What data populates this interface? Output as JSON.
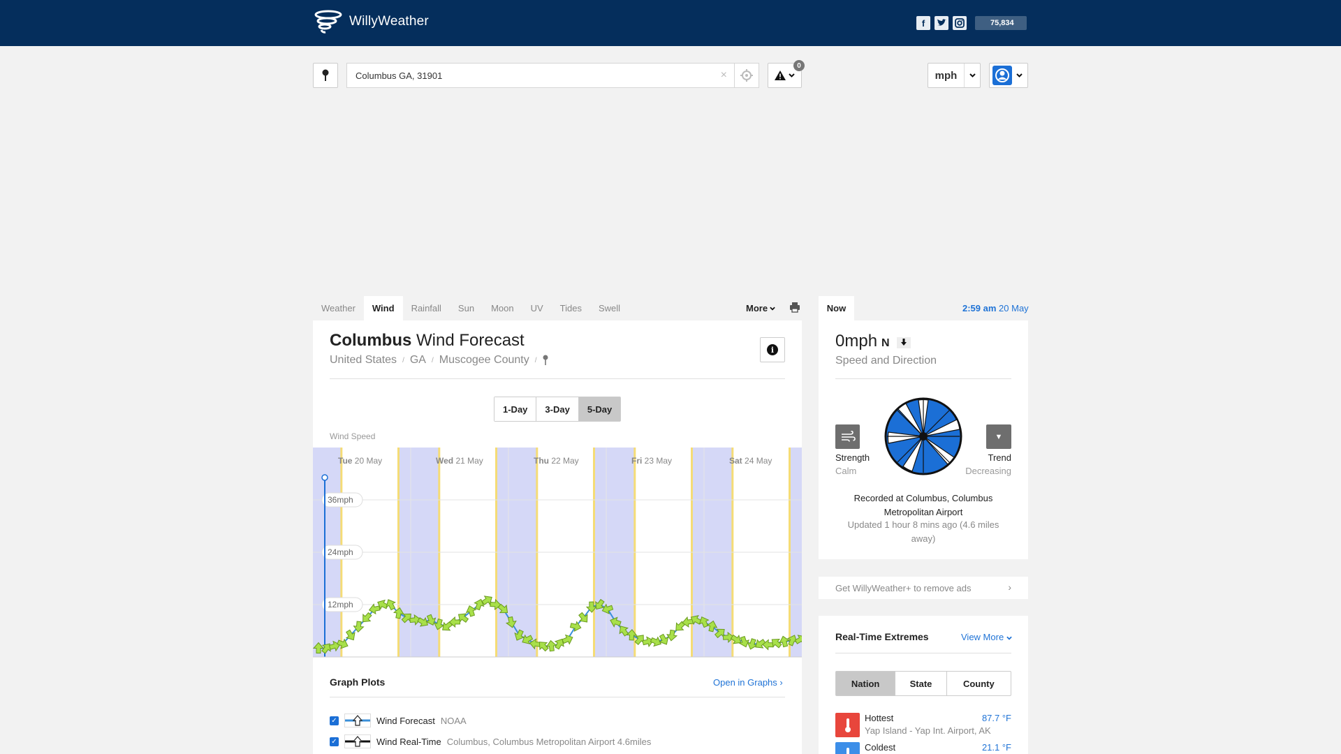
{
  "header": {
    "app_name": "WillyWeather",
    "fans_count": "75,834",
    "social": [
      "f",
      "t",
      "ig"
    ]
  },
  "search": {
    "value": "Columbus GA, 31901",
    "clear_label": "×",
    "alert_count": "0"
  },
  "units": {
    "selected": "mph"
  },
  "tabs": {
    "items": [
      "Weather",
      "Wind",
      "Rainfall",
      "Sun",
      "Moon",
      "UV",
      "Tides",
      "Swell"
    ],
    "active": "Wind",
    "more_label": "More"
  },
  "forecast": {
    "city": "Columbus",
    "title_suffix": "Wind Forecast",
    "breadcrumbs": [
      "United States",
      "GA",
      "Muscogee County"
    ],
    "ranges": [
      "1-Day",
      "3-Day",
      "5-Day"
    ],
    "selected_range": "5-Day",
    "chart_label": "Wind Speed"
  },
  "chart_data": {
    "type": "line",
    "days": [
      {
        "dow": "Tue",
        "date": "20 May"
      },
      {
        "dow": "Wed",
        "date": "21 May"
      },
      {
        "dow": "Thu",
        "date": "22 May"
      },
      {
        "dow": "Fri",
        "date": "23 May"
      },
      {
        "dow": "Sat",
        "date": "24 May"
      }
    ],
    "y_ticks": [
      "36mph",
      "24mph",
      "12mph"
    ],
    "y_tick_values": [
      36,
      24,
      12
    ],
    "ylim": [
      0,
      48
    ],
    "hours_span": 120,
    "night_bands": [
      [
        0,
        7
      ],
      [
        21,
        31
      ],
      [
        45,
        55
      ],
      [
        69,
        79
      ],
      [
        93,
        103
      ],
      [
        117,
        120
      ]
    ],
    "series": [
      {
        "values": [
          2,
          2,
          2.5,
          3,
          5,
          7,
          9,
          11,
          12,
          12,
          10,
          9,
          8.5,
          8,
          8.5,
          7.5,
          7,
          8,
          9,
          10.5,
          12,
          13,
          12,
          11,
          8,
          5,
          4,
          3,
          2.5,
          2.5,
          3,
          4,
          7,
          9,
          11.5,
          12,
          11,
          8,
          6,
          5,
          4,
          3.5,
          3.5,
          4,
          5,
          7,
          8,
          8.5,
          8,
          7,
          5.5,
          4.5,
          4,
          3.5,
          3,
          3,
          2.8,
          3.2,
          3.5,
          3.8,
          4
        ]
      }
    ]
  },
  "graph_plots": {
    "title": "Graph Plots",
    "open_label": "Open in Graphs",
    "rows": [
      {
        "name": "Wind Forecast",
        "source": "NOAA"
      },
      {
        "name": "Wind Real-Time",
        "source": "Columbus, Columbus Metropolitan Airport 4.6miles"
      }
    ]
  },
  "now": {
    "tab_label": "Now",
    "time": "2:59 am",
    "date": "20 May",
    "speed": "0mph",
    "direction": "N",
    "speed_label": "Speed and Direction",
    "strength_label": "Strength",
    "strength_value": "Calm",
    "trend_label": "Trend",
    "trend_value": "Decreasing",
    "recorded": "Recorded at Columbus, Columbus Metropolitan Airport",
    "updated": "Updated 1 hour 8 mins ago (4.6 miles away)"
  },
  "promo": {
    "text": "Get WillyWeather+ to remove ads"
  },
  "extremes": {
    "title": "Real-Time Extremes",
    "view_more": "View More",
    "scopes": [
      "Nation",
      "State",
      "County"
    ],
    "selected_scope": "Nation",
    "rows": [
      {
        "label": "Hottest",
        "place": "Yap Island - Yap Int. Airport, AK",
        "value": "87.7 °F",
        "color": "#e8463c"
      },
      {
        "label": "Coldest",
        "place": "",
        "value": "21.1 °F",
        "color": "#3c8ee8"
      }
    ]
  },
  "colors": {
    "header_bg": "#052e5c",
    "accent": "#1f73d6",
    "night_band": "#d5d8f7",
    "day_border": "#f5dc76",
    "wind_line": "#3a8fd9",
    "wind_arrow": "#a8e04a"
  }
}
